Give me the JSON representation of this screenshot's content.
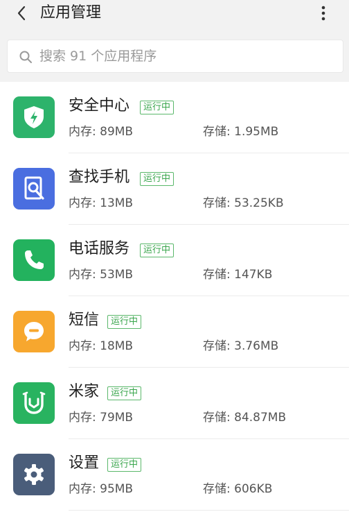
{
  "header": {
    "title": "应用管理"
  },
  "search": {
    "placeholder": "搜索 91 个应用程序"
  },
  "apps": [
    {
      "name": "安全中心",
      "status": "运行中",
      "memory": "内存: 89MB",
      "storage": "存储: 1.95MB",
      "icon": "shield-bolt-icon",
      "color": "#2db36b"
    },
    {
      "name": "查找手机",
      "status": "运行中",
      "memory": "内存: 13MB",
      "storage": "存储: 53.25KB",
      "icon": "find-phone-icon",
      "color": "#4a6ee0"
    },
    {
      "name": "电话服务",
      "status": "运行中",
      "memory": "内存: 53MB",
      "storage": "存储: 147KB",
      "icon": "phone-icon",
      "color": "#23b25e"
    },
    {
      "name": "短信",
      "status": "运行中",
      "memory": "内存: 18MB",
      "storage": "存储: 3.76MB",
      "icon": "message-icon",
      "color": "#f7a72e"
    },
    {
      "name": "米家",
      "status": "运行中",
      "memory": "内存: 79MB",
      "storage": "存储: 84.87MB",
      "icon": "mijia-icon",
      "color": "#29b360"
    },
    {
      "name": "设置",
      "status": "运行中",
      "memory": "内存: 95MB",
      "storage": "存储: 606KB",
      "icon": "gear-icon",
      "color": "#4a5d7a"
    }
  ]
}
